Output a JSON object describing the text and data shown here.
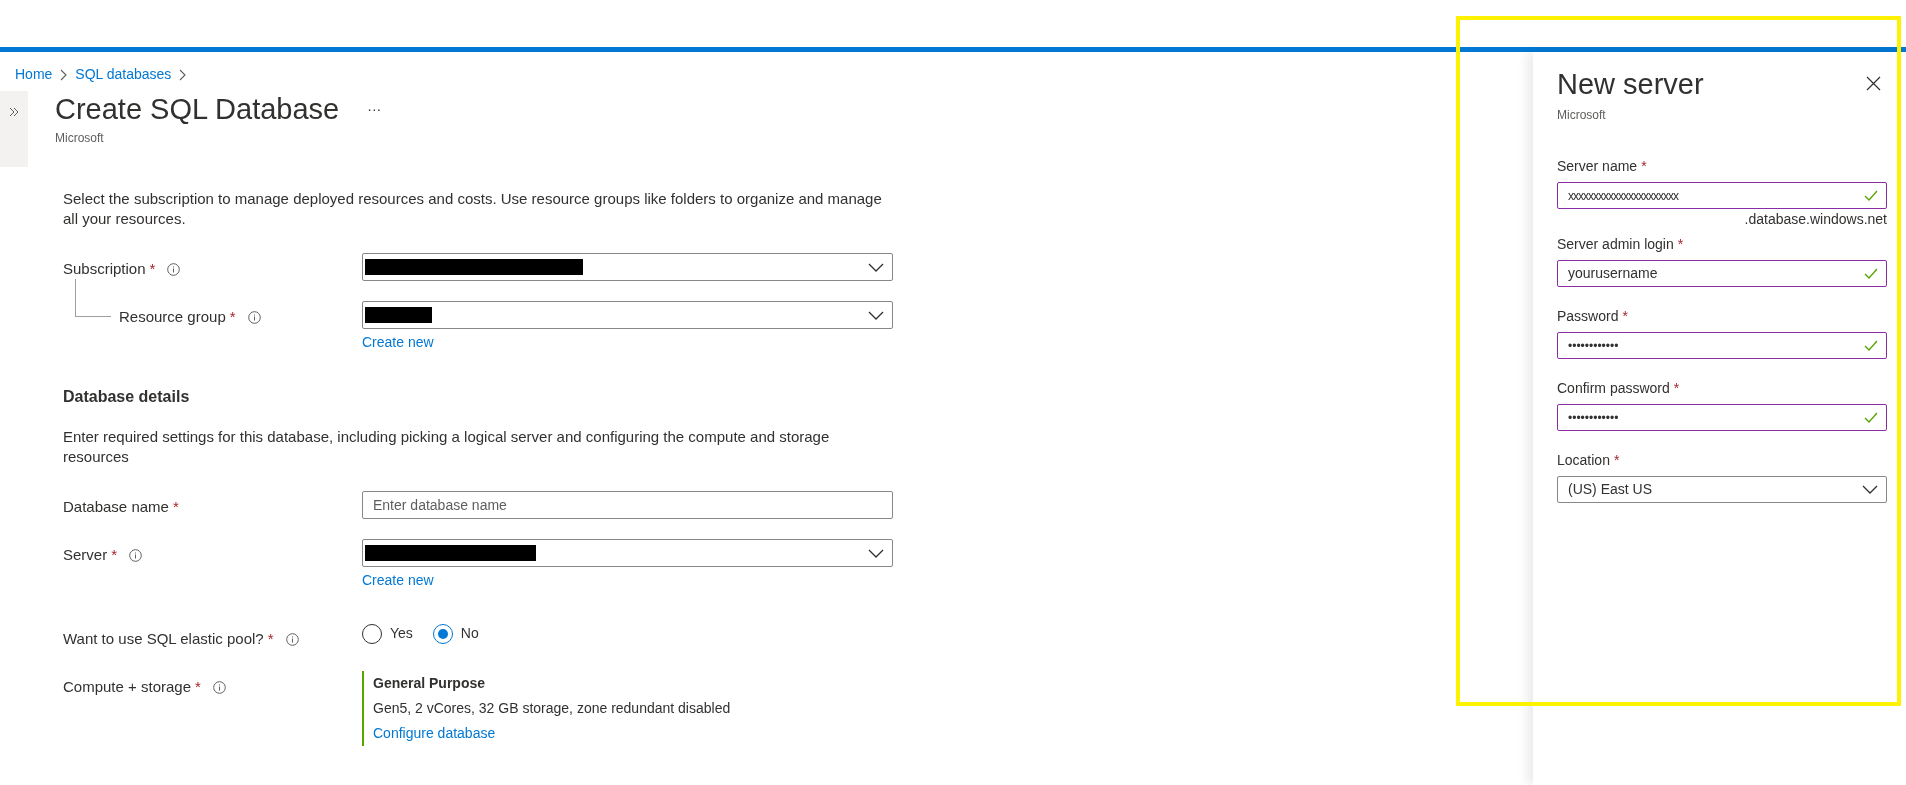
{
  "breadcrumb": [
    "Home",
    "SQL databases"
  ],
  "page": {
    "title": "Create SQL Database",
    "more": "···",
    "publisher": "Microsoft"
  },
  "project_details": {
    "description": "Select the subscription to manage deployed resources and costs. Use resource groups like folders to organize and manage all your resources.",
    "fields": [
      {
        "label": "Subscription",
        "asterisk": "*",
        "info": true,
        "kind": "redacted_select",
        "nested": false
      },
      {
        "label": "Resource group",
        "asterisk": "*",
        "info": true,
        "kind": "redacted_select",
        "nested": true,
        "link": "Create new"
      }
    ]
  },
  "database_details": {
    "heading": "Database details",
    "description": "Enter required settings for this database, including picking a logical server and configuring the compute and storage resources",
    "fields": [
      {
        "label": "Database name",
        "asterisk": "*",
        "info": false,
        "kind": "text",
        "placeholder": "Enter database name"
      },
      {
        "label": "Server",
        "asterisk": "*",
        "info": true,
        "kind": "redacted_select",
        "link": "Create new"
      },
      {
        "label": "Want to use SQL elastic pool?",
        "asterisk": "*",
        "info": true,
        "kind": "radio",
        "options": [
          {
            "label": "Yes",
            "selected": false
          },
          {
            "label": "No",
            "selected": true
          }
        ]
      },
      {
        "label": "Compute + storage",
        "asterisk": "*",
        "info": true,
        "kind": "summary",
        "title": "General Purpose",
        "detail": "Gen5, 2 vCores, 32 GB storage, zone redundant disabled",
        "link": "Configure database"
      }
    ]
  },
  "panel": {
    "title": "New server",
    "publisher": "Microsoft",
    "fields": [
      {
        "label": "Server name",
        "asterisk": "*",
        "kind": "text",
        "value": "xxxxxxxxxxxxxxxxxxxxxx",
        "valid": true,
        "suffix": ".database.windows.net"
      },
      {
        "label": "Server admin login",
        "asterisk": "*",
        "kind": "text",
        "value": "yourusername",
        "valid": true
      },
      {
        "label": "Password",
        "asterisk": "*",
        "kind": "password",
        "value": "••••••••••••",
        "valid": true
      },
      {
        "label": "Confirm password",
        "asterisk": "*",
        "kind": "password",
        "value": "••••••••••••",
        "valid": true
      },
      {
        "label": "Location",
        "asterisk": "*",
        "kind": "select",
        "value": "(US) East US"
      }
    ]
  }
}
